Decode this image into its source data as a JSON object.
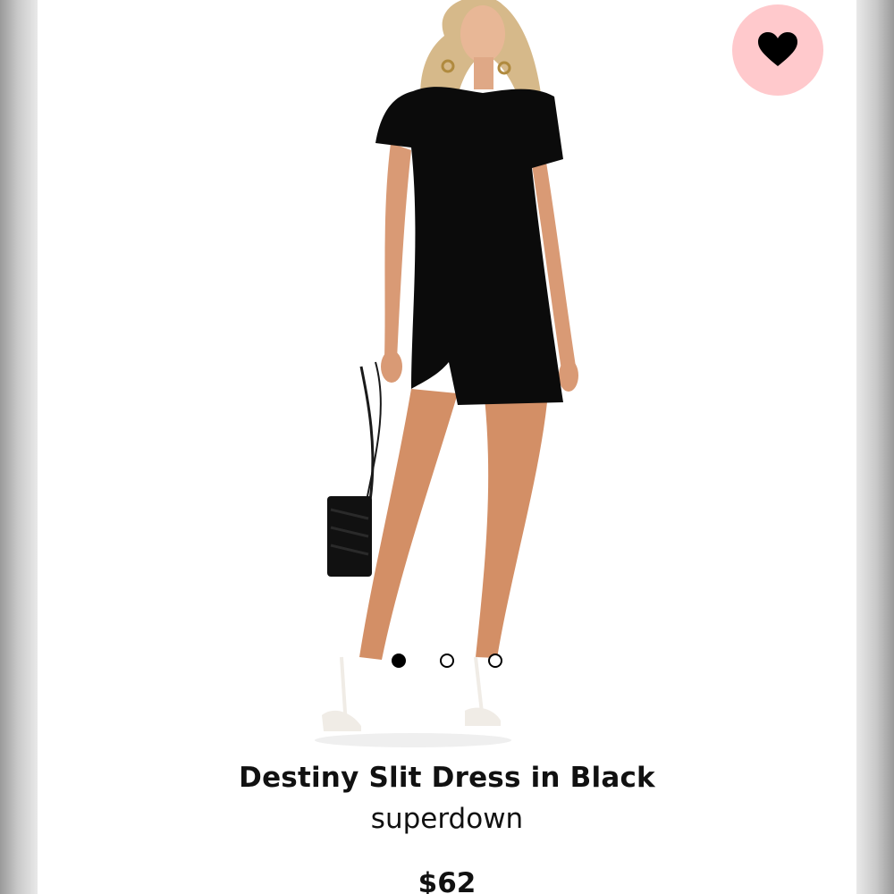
{
  "product": {
    "title": "Destiny Slit Dress in Black",
    "brand": "superdown",
    "price": "$62"
  },
  "favorite": {
    "icon": "heart-icon",
    "background_color": "#ffc9cc",
    "icon_color": "#000000"
  },
  "carousel": {
    "total_images": 3,
    "active_index": 0
  }
}
